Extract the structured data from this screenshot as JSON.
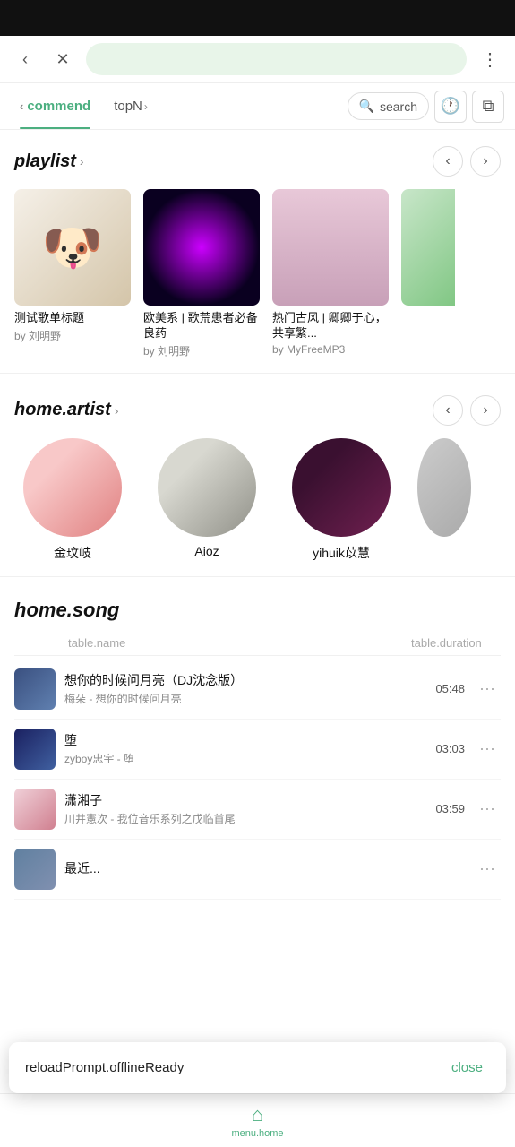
{
  "statusBar": {},
  "browserChrome": {
    "back": "‹",
    "close": "✕",
    "more": "⋮"
  },
  "navTabs": {
    "items": [
      {
        "id": "commend",
        "label": "commend",
        "active": true
      },
      {
        "id": "topN",
        "label": "topN",
        "active": false
      }
    ],
    "search": {
      "placeholder": "search"
    },
    "iconHistory": "🕐",
    "iconDisplay": "⧉"
  },
  "playlist": {
    "sectionTitle": "playlist",
    "chevron": ">",
    "items": [
      {
        "title": "测试歌单标题",
        "by": "by 刘明野",
        "thumbClass": "thumb-dog"
      },
      {
        "title": "欧美系 | 歌荒患者必备良药",
        "by": "by 刘明野",
        "thumbClass": "thumb-purple"
      },
      {
        "title": "热门古风 | 卿卿于心，共享繁...",
        "by": "by MyFreeMP3",
        "thumbClass": "thumb-girl"
      }
    ]
  },
  "homeArtist": {
    "sectionTitle": "home.artist",
    "chevron": ">",
    "items": [
      {
        "name": "金玟岐",
        "avatarClass": "avatar-girl"
      },
      {
        "name": "Aioz",
        "avatarClass": "avatar-guy"
      },
      {
        "name": "yihuik苡慧",
        "avatarClass": "avatar-city"
      }
    ]
  },
  "homeSong": {
    "sectionTitle": "home.song",
    "table": {
      "colName": "table.name",
      "colDuration": "table.duration"
    },
    "items": [
      {
        "title": "想你的时候问月亮（DJ沈念版）",
        "artist": "梅朵 - 想你的时候问月亮",
        "duration": "05:48",
        "thumbClass": "song-thumb-1"
      },
      {
        "title": "堕",
        "artist": "zyboy忠宇 - 堕",
        "duration": "03:03",
        "thumbClass": "song-thumb-2"
      },
      {
        "title": "潇湘子",
        "artist": "川井憲次 - 我位音乐系列之戊临首尾",
        "duration": "03:59",
        "thumbClass": "song-thumb-3"
      },
      {
        "title": "最近...",
        "artist": "",
        "duration": "",
        "thumbClass": "song-thumb-4"
      }
    ]
  },
  "offlineToast": {
    "message": "reloadPrompt.offlineReady",
    "closeLabel": "close"
  },
  "bottomNav": {
    "icon": "⌂",
    "label": "menu.home"
  }
}
